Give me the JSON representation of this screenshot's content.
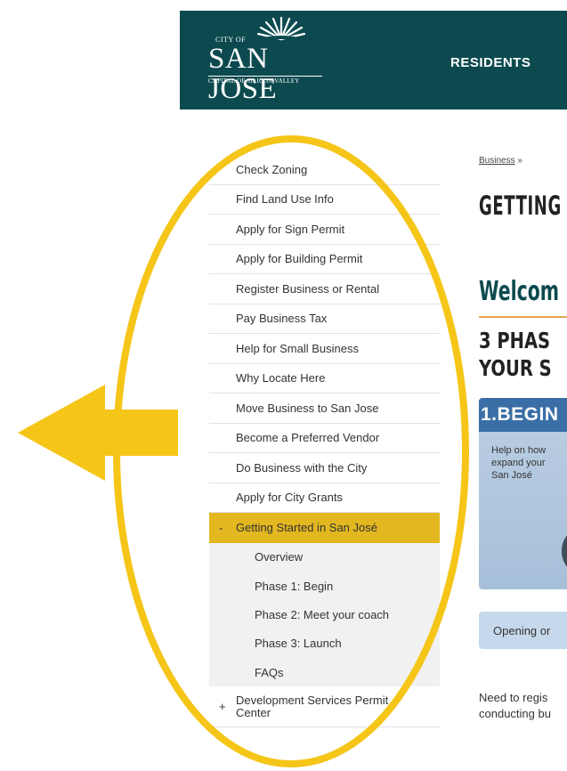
{
  "header": {
    "logo": {
      "city_of": "CITY OF",
      "name": "SAN JOSE",
      "tagline": "CAPITAL OF SILICON VALLEY"
    },
    "nav_item": "RESIDENTS"
  },
  "sidebar": {
    "items": [
      "Check Zoning",
      "Find Land Use Info",
      "Apply for Sign Permit",
      "Apply for Building Permit",
      "Register Business or Rental",
      "Pay Business Tax",
      "Help for Small Business",
      "Why Locate Here",
      "Move Business to San Jose",
      "Become a Preferred Vendor",
      "Do Business with the City",
      "Apply for City Grants"
    ],
    "active": {
      "prefix": "-",
      "label": "Getting Started in San José"
    },
    "subitems": [
      "Overview",
      "Phase 1: Begin",
      "Phase 2: Meet your coach",
      "Phase 3: Launch",
      "FAQs"
    ],
    "last": {
      "prefix": "+",
      "label_line1": "Development Services Permit",
      "label_line2": "Center"
    }
  },
  "main": {
    "breadcrumb": "Business",
    "breadcrumb_sep": "»",
    "title": "GETTING",
    "welcome": "Welcom",
    "phases_line1": "3 PHAS",
    "phases_line2": "YOUR S",
    "phase_box": {
      "heading": "1.BEGIN",
      "line1": "Help on how",
      "line2": "expand your",
      "line3": "San José"
    },
    "open_button": "Opening or",
    "para_line1": "Need to regis",
    "para_line2": "conducting bu"
  },
  "annotation": {
    "color": "#f5c518"
  }
}
